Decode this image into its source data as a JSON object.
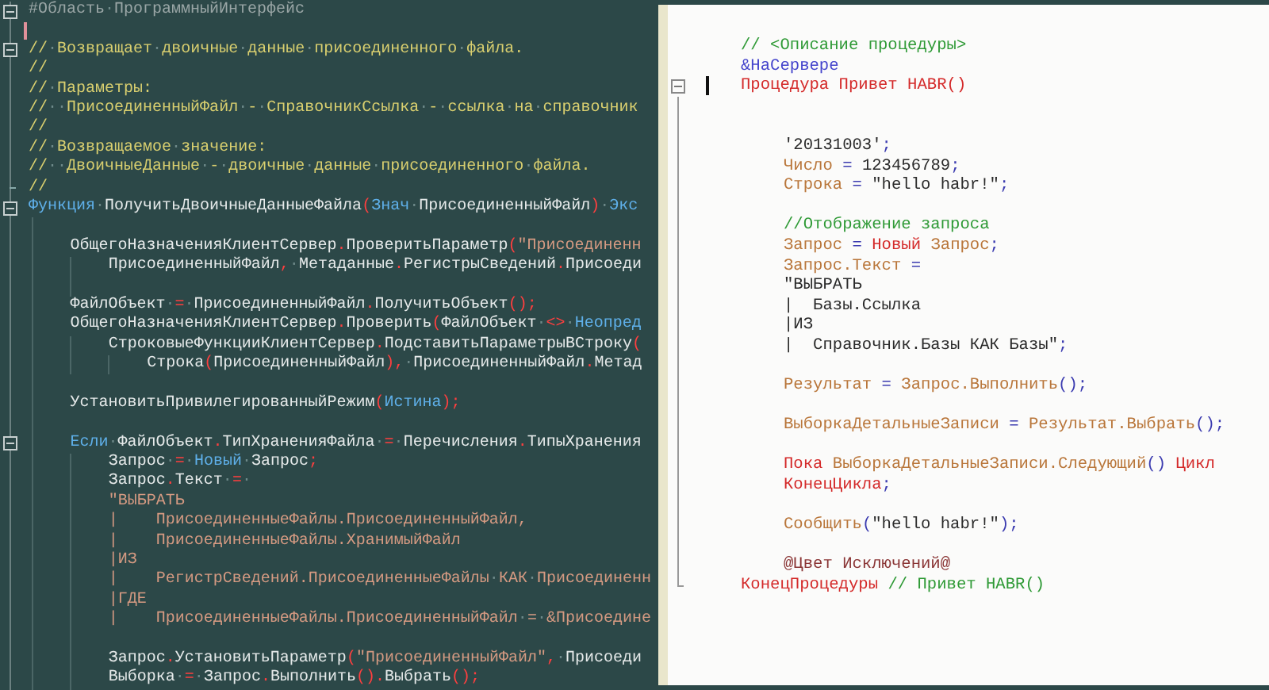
{
  "left_editor": {
    "lines": [
      {
        "kind": "code",
        "foldable": true,
        "fold_end": false,
        "cursor": false,
        "tokens": [
          {
            "kind": "preprocessor",
            "text": "#Область·ПрограммныйИнтерфейс"
          }
        ]
      },
      {
        "kind": "blank",
        "foldable": false,
        "fold_end": false,
        "cursor": true
      },
      {
        "kind": "code",
        "foldable": true,
        "fold_end": false,
        "cursor": false,
        "tokens": [
          {
            "kind": "comment",
            "text": "//·Возвращает·двоичные·данные·присоединенного·файла."
          }
        ]
      },
      {
        "kind": "code",
        "foldable": false,
        "fold_end": false,
        "cursor": false,
        "tokens": [
          {
            "kind": "comment",
            "text": "//"
          }
        ]
      },
      {
        "kind": "code",
        "foldable": false,
        "fold_end": false,
        "cursor": false,
        "tokens": [
          {
            "kind": "comment",
            "text": "//·Параметры:"
          }
        ]
      },
      {
        "kind": "code",
        "foldable": false,
        "fold_end": false,
        "cursor": false,
        "tokens": [
          {
            "kind": "comment",
            "text": "//··ПрисоединенныйФайл·-·СправочникСсылка·-·ссылка·на·справочник"
          }
        ]
      },
      {
        "kind": "code",
        "foldable": false,
        "fold_end": false,
        "cursor": false,
        "tokens": [
          {
            "kind": "comment",
            "text": "//"
          }
        ]
      },
      {
        "kind": "code",
        "foldable": false,
        "fold_end": false,
        "cursor": false,
        "tokens": [
          {
            "kind": "comment",
            "text": "//·Возвращаемое·значение:"
          }
        ]
      },
      {
        "kind": "code",
        "foldable": false,
        "fold_end": false,
        "cursor": false,
        "tokens": [
          {
            "kind": "comment",
            "text": "//··ДвоичныеДанные·-·двоичные·данные·присоединенного·файла."
          }
        ]
      },
      {
        "kind": "code",
        "foldable": false,
        "fold_end": true,
        "cursor": false,
        "tokens": [
          {
            "kind": "comment",
            "text": "//"
          }
        ]
      },
      {
        "kind": "code",
        "foldable": true,
        "fold_end": false,
        "cursor": false,
        "tokens": [
          {
            "kind": "keyword",
            "text": "Функция"
          },
          {
            "kind": "name",
            "text": "·ПолучитьДвоичныеДанныеФайла"
          },
          {
            "kind": "operator",
            "text": "("
          },
          {
            "kind": "keyword",
            "text": "Знач"
          },
          {
            "kind": "name",
            "text": "·ПрисоединенныйФайл"
          },
          {
            "kind": "operator",
            "text": ")"
          },
          {
            "kind": "name",
            "text": "·"
          },
          {
            "kind": "keyword",
            "text": "Экс"
          }
        ],
        "children": [
          {
            "kind": "blank",
            "foldable": false,
            "fold_end": false,
            "cursor": false
          },
          {
            "kind": "code",
            "foldable": false,
            "fold_end": false,
            "cursor": false,
            "tokens": [
              {
                "kind": "name",
                "text": "ОбщегоНазначенияКлиентСервер"
              },
              {
                "kind": "operator",
                "text": "."
              },
              {
                "kind": "name",
                "text": "ПроверитьПараметр"
              },
              {
                "kind": "operator",
                "text": "("
              },
              {
                "kind": "string",
                "text": "\"Присоединенн"
              }
            ],
            "children": [
              {
                "kind": "code",
                "foldable": false,
                "fold_end": false,
                "cursor": false,
                "tokens": [
                  {
                    "kind": "name",
                    "text": "ПрисоединенныйФайл"
                  },
                  {
                    "kind": "operator",
                    "text": ","
                  },
                  {
                    "kind": "name",
                    "text": "·Метаданные"
                  },
                  {
                    "kind": "operator",
                    "text": "."
                  },
                  {
                    "kind": "name",
                    "text": "РегистрыСведений"
                  },
                  {
                    "kind": "operator",
                    "text": "."
                  },
                  {
                    "kind": "name",
                    "text": "Присоеди"
                  }
                ]
              },
              {
                "kind": "blank",
                "foldable": false,
                "fold_end": false,
                "cursor": false
              }
            ]
          },
          {
            "kind": "code",
            "foldable": false,
            "fold_end": false,
            "cursor": false,
            "tokens": [
              {
                "kind": "name",
                "text": "ФайлОбъект·"
              },
              {
                "kind": "operator",
                "text": "="
              },
              {
                "kind": "name",
                "text": "·ПрисоединенныйФайл"
              },
              {
                "kind": "operator",
                "text": "."
              },
              {
                "kind": "name",
                "text": "ПолучитьОбъект"
              },
              {
                "kind": "operator",
                "text": "();"
              }
            ]
          },
          {
            "kind": "code",
            "foldable": false,
            "fold_end": false,
            "cursor": false,
            "tokens": [
              {
                "kind": "name",
                "text": "ОбщегоНазначенияКлиентСервер"
              },
              {
                "kind": "operator",
                "text": "."
              },
              {
                "kind": "name",
                "text": "Проверить"
              },
              {
                "kind": "operator",
                "text": "("
              },
              {
                "kind": "name",
                "text": "ФайлОбъект·"
              },
              {
                "kind": "operator",
                "text": "<>"
              },
              {
                "kind": "name",
                "text": "·"
              },
              {
                "kind": "keyword",
                "text": "Неопред"
              }
            ],
            "children": [
              {
                "kind": "code",
                "foldable": false,
                "fold_end": false,
                "cursor": false,
                "tokens": [
                  {
                    "kind": "name",
                    "text": "СтроковыеФункцииКлиентСервер"
                  },
                  {
                    "kind": "operator",
                    "text": "."
                  },
                  {
                    "kind": "name",
                    "text": "ПодставитьПараметрыВСтроку"
                  },
                  {
                    "kind": "operator",
                    "text": "("
                  }
                ],
                "children": [
                  {
                    "kind": "code",
                    "foldable": false,
                    "fold_end": false,
                    "cursor": false,
                    "tokens": [
                      {
                        "kind": "name",
                        "text": "Строка"
                      },
                      {
                        "kind": "operator",
                        "text": "("
                      },
                      {
                        "kind": "name",
                        "text": "ПрисоединенныйФайл"
                      },
                      {
                        "kind": "operator",
                        "text": "),"
                      },
                      {
                        "kind": "name",
                        "text": "·ПрисоединенныйФайл"
                      },
                      {
                        "kind": "operator",
                        "text": "."
                      },
                      {
                        "kind": "name",
                        "text": "Метад"
                      }
                    ]
                  }
                ]
              }
            ]
          },
          {
            "kind": "blank",
            "foldable": false,
            "fold_end": false,
            "cursor": false
          },
          {
            "kind": "code",
            "foldable": false,
            "fold_end": false,
            "cursor": false,
            "tokens": [
              {
                "kind": "name",
                "text": "УстановитьПривилегированныйРежим"
              },
              {
                "kind": "operator",
                "text": "("
              },
              {
                "kind": "keyword",
                "text": "Истина"
              },
              {
                "kind": "operator",
                "text": ");"
              }
            ]
          },
          {
            "kind": "blank",
            "foldable": false,
            "fold_end": false,
            "cursor": false
          },
          {
            "kind": "code",
            "foldable": true,
            "fold_end": false,
            "cursor": false,
            "tokens": [
              {
                "kind": "keyword",
                "text": "Если"
              },
              {
                "kind": "name",
                "text": "·ФайлОбъект"
              },
              {
                "kind": "operator",
                "text": "."
              },
              {
                "kind": "name",
                "text": "ТипХраненияФайла·"
              },
              {
                "kind": "operator",
                "text": "="
              },
              {
                "kind": "name",
                "text": "·Перечисления"
              },
              {
                "kind": "operator",
                "text": "."
              },
              {
                "kind": "name",
                "text": "ТипыХранения"
              }
            ],
            "children": [
              {
                "kind": "code",
                "foldable": false,
                "fold_end": false,
                "cursor": false,
                "tokens": [
                  {
                    "kind": "name",
                    "text": "Запрос·"
                  },
                  {
                    "kind": "operator",
                    "text": "="
                  },
                  {
                    "kind": "name",
                    "text": "·"
                  },
                  {
                    "kind": "keyword",
                    "text": "Новый"
                  },
                  {
                    "kind": "name",
                    "text": "·Запрос"
                  },
                  {
                    "kind": "operator",
                    "text": ";"
                  }
                ]
              },
              {
                "kind": "code",
                "foldable": false,
                "fold_end": false,
                "cursor": false,
                "tokens": [
                  {
                    "kind": "name",
                    "text": "Запрос"
                  },
                  {
                    "kind": "operator",
                    "text": "."
                  },
                  {
                    "kind": "name",
                    "text": "Текст·"
                  },
                  {
                    "kind": "operator",
                    "text": "="
                  },
                  {
                    "kind": "name",
                    "text": "·"
                  }
                ]
              },
              {
                "kind": "code",
                "foldable": false,
                "fold_end": false,
                "cursor": false,
                "tokens": [
                  {
                    "kind": "string",
                    "text": "\"ВЫБРАТЬ"
                  }
                ]
              },
              {
                "kind": "code",
                "foldable": false,
                "fold_end": false,
                "cursor": false,
                "tokens": [
                  {
                    "kind": "string",
                    "text": "|    ПрисоединенныеФайлы.ПрисоединенныйФайл,"
                  }
                ]
              },
              {
                "kind": "code",
                "foldable": false,
                "fold_end": false,
                "cursor": false,
                "tokens": [
                  {
                    "kind": "string",
                    "text": "|    ПрисоединенныеФайлы.ХранимыйФайл"
                  }
                ]
              },
              {
                "kind": "code",
                "foldable": false,
                "fold_end": false,
                "cursor": false,
                "tokens": [
                  {
                    "kind": "string",
                    "text": "|ИЗ"
                  }
                ]
              },
              {
                "kind": "code",
                "foldable": false,
                "fold_end": false,
                "cursor": false,
                "tokens": [
                  {
                    "kind": "string",
                    "text": "|    РегистрСведений.ПрисоединенныеФайлы·КАК·Присоединенн"
                  }
                ]
              },
              {
                "kind": "code",
                "foldable": false,
                "fold_end": false,
                "cursor": false,
                "tokens": [
                  {
                    "kind": "string",
                    "text": "|ГДЕ"
                  }
                ]
              },
              {
                "kind": "code",
                "foldable": false,
                "fold_end": false,
                "cursor": false,
                "tokens": [
                  {
                    "kind": "string",
                    "text": "|    ПрисоединенныеФайлы.ПрисоединенныйФайл·=·&Присоедине"
                  }
                ]
              },
              {
                "kind": "blank",
                "foldable": false,
                "fold_end": false,
                "cursor": false
              },
              {
                "kind": "code",
                "foldable": false,
                "fold_end": false,
                "cursor": false,
                "tokens": [
                  {
                    "kind": "name",
                    "text": "Запрос"
                  },
                  {
                    "kind": "operator",
                    "text": "."
                  },
                  {
                    "kind": "name",
                    "text": "УстановитьПараметр"
                  },
                  {
                    "kind": "operator",
                    "text": "("
                  },
                  {
                    "kind": "string",
                    "text": "\"ПрисоединенныйФайл\""
                  },
                  {
                    "kind": "operator",
                    "text": ","
                  },
                  {
                    "kind": "name",
                    "text": "·Присоеди"
                  }
                ]
              },
              {
                "kind": "code",
                "foldable": false,
                "fold_end": false,
                "cursor": false,
                "tokens": [
                  {
                    "kind": "name",
                    "text": "Выборка·"
                  },
                  {
                    "kind": "operator",
                    "text": "="
                  },
                  {
                    "kind": "name",
                    "text": "·Запрос"
                  },
                  {
                    "kind": "operator",
                    "text": "."
                  },
                  {
                    "kind": "name",
                    "text": "Выполнить"
                  },
                  {
                    "kind": "operator",
                    "text": "()."
                  },
                  {
                    "kind": "name",
                    "text": "Выбрать"
                  },
                  {
                    "kind": "operator",
                    "text": "();"
                  }
                ]
              }
            ]
          }
        ]
      }
    ]
  },
  "right_editor": {
    "lines": [
      {
        "kind": "code",
        "foldable": false,
        "fold_end": false,
        "cursor": false,
        "tokens": [
          {
            "kind": "comment",
            "text": "// <Описание процедуры>"
          }
        ]
      },
      {
        "kind": "code",
        "foldable": false,
        "fold_end": false,
        "cursor": false,
        "tokens": [
          {
            "kind": "preprocessor",
            "text": "&НаСервере"
          }
        ]
      },
      {
        "kind": "code",
        "foldable": true,
        "fold_end": false,
        "cursor": true,
        "tokens": [
          {
            "kind": "keyword",
            "text": "Процедура Привет HABR()"
          }
        ],
        "children": [
          {
            "kind": "blank",
            "foldable": false,
            "fold_end": false,
            "cursor": false
          },
          {
            "kind": "blank",
            "foldable": false,
            "fold_end": false,
            "cursor": false
          },
          {
            "kind": "code",
            "foldable": false,
            "fold_end": false,
            "cursor": false,
            "tokens": [
              {
                "kind": "string",
                "text": "'20131003'"
              },
              {
                "kind": "operator",
                "text": ";"
              }
            ]
          },
          {
            "kind": "code",
            "foldable": false,
            "fold_end": false,
            "cursor": false,
            "tokens": [
              {
                "kind": "name",
                "text": "Число"
              },
              {
                "kind": "operator",
                "text": " = "
              },
              {
                "kind": "string",
                "text": "123456789"
              },
              {
                "kind": "operator",
                "text": ";"
              }
            ]
          },
          {
            "kind": "code",
            "foldable": false,
            "fold_end": false,
            "cursor": false,
            "tokens": [
              {
                "kind": "name",
                "text": "Строка"
              },
              {
                "kind": "operator",
                "text": " = "
              },
              {
                "kind": "string",
                "text": "\"hello habr!\""
              },
              {
                "kind": "operator",
                "text": ";"
              }
            ]
          },
          {
            "kind": "blank",
            "foldable": false,
            "fold_end": false,
            "cursor": false
          },
          {
            "kind": "code",
            "foldable": false,
            "fold_end": false,
            "cursor": false,
            "tokens": [
              {
                "kind": "comment",
                "text": "//Отображение запроса"
              }
            ]
          },
          {
            "kind": "code",
            "foldable": false,
            "fold_end": false,
            "cursor": false,
            "tokens": [
              {
                "kind": "name",
                "text": "Запрос"
              },
              {
                "kind": "operator",
                "text": " = "
              },
              {
                "kind": "keyword",
                "text": "Новый"
              },
              {
                "kind": "name",
                "text": " Запрос"
              },
              {
                "kind": "operator",
                "text": ";"
              }
            ]
          },
          {
            "kind": "code",
            "foldable": false,
            "fold_end": false,
            "cursor": false,
            "tokens": [
              {
                "kind": "name",
                "text": "Запрос.Текст"
              },
              {
                "kind": "operator",
                "text": " ="
              }
            ]
          },
          {
            "kind": "code",
            "foldable": false,
            "fold_end": false,
            "cursor": false,
            "tokens": [
              {
                "kind": "string",
                "text": "\"ВЫБРАТЬ"
              }
            ]
          },
          {
            "kind": "code",
            "foldable": false,
            "fold_end": false,
            "cursor": false,
            "tokens": [
              {
                "kind": "string",
                "text": "|  Базы.Ссылка"
              }
            ]
          },
          {
            "kind": "code",
            "foldable": false,
            "fold_end": false,
            "cursor": false,
            "tokens": [
              {
                "kind": "string",
                "text": "|ИЗ"
              }
            ]
          },
          {
            "kind": "code",
            "foldable": false,
            "fold_end": false,
            "cursor": false,
            "tokens": [
              {
                "kind": "string",
                "text": "|  Справочник.Базы КАК Базы\""
              },
              {
                "kind": "operator",
                "text": ";"
              }
            ]
          },
          {
            "kind": "blank",
            "foldable": false,
            "fold_end": false,
            "cursor": false
          },
          {
            "kind": "code",
            "foldable": false,
            "fold_end": false,
            "cursor": false,
            "tokens": [
              {
                "kind": "name",
                "text": "Результат"
              },
              {
                "kind": "operator",
                "text": " = "
              },
              {
                "kind": "name",
                "text": "Запрос.Выполнить"
              },
              {
                "kind": "operator",
                "text": "();"
              }
            ]
          },
          {
            "kind": "blank",
            "foldable": false,
            "fold_end": false,
            "cursor": false
          },
          {
            "kind": "code",
            "foldable": false,
            "fold_end": false,
            "cursor": false,
            "tokens": [
              {
                "kind": "name",
                "text": "ВыборкаДетальныеЗаписи"
              },
              {
                "kind": "operator",
                "text": " = "
              },
              {
                "kind": "name",
                "text": "Результат.Выбрать"
              },
              {
                "kind": "operator",
                "text": "();"
              }
            ]
          },
          {
            "kind": "blank",
            "foldable": false,
            "fold_end": false,
            "cursor": false
          },
          {
            "kind": "code",
            "foldable": false,
            "fold_end": false,
            "cursor": false,
            "tokens": [
              {
                "kind": "keyword",
                "text": "Пока"
              },
              {
                "kind": "name",
                "text": " ВыборкаДетальныеЗаписи.Следующий"
              },
              {
                "kind": "operator",
                "text": "() "
              },
              {
                "kind": "keyword",
                "text": "Цикл"
              }
            ]
          },
          {
            "kind": "code",
            "foldable": false,
            "fold_end": false,
            "cursor": false,
            "tokens": [
              {
                "kind": "keyword",
                "text": "КонецЦикла"
              },
              {
                "kind": "operator",
                "text": ";"
              }
            ]
          },
          {
            "kind": "blank",
            "foldable": false,
            "fold_end": false,
            "cursor": false
          },
          {
            "kind": "code",
            "foldable": false,
            "fold_end": false,
            "cursor": false,
            "tokens": [
              {
                "kind": "name",
                "text": "Сообщить"
              },
              {
                "kind": "operator",
                "text": "("
              },
              {
                "kind": "string",
                "text": "\"hello habr!\""
              },
              {
                "kind": "operator",
                "text": ");"
              }
            ]
          },
          {
            "kind": "blank",
            "foldable": false,
            "fold_end": false,
            "cursor": false
          },
          {
            "kind": "code",
            "foldable": false,
            "fold_end": false,
            "cursor": false,
            "tokens": [
              {
                "kind": "annotation",
                "text": "@Цвет Исключений@"
              }
            ]
          }
        ]
      },
      {
        "kind": "code",
        "foldable": false,
        "fold_end": true,
        "cursor": false,
        "tokens": [
          {
            "kind": "keyword",
            "text": "КонецПроцедуры"
          },
          {
            "kind": "comment",
            "text": " // Привет HABR()"
          }
        ]
      }
    ]
  }
}
